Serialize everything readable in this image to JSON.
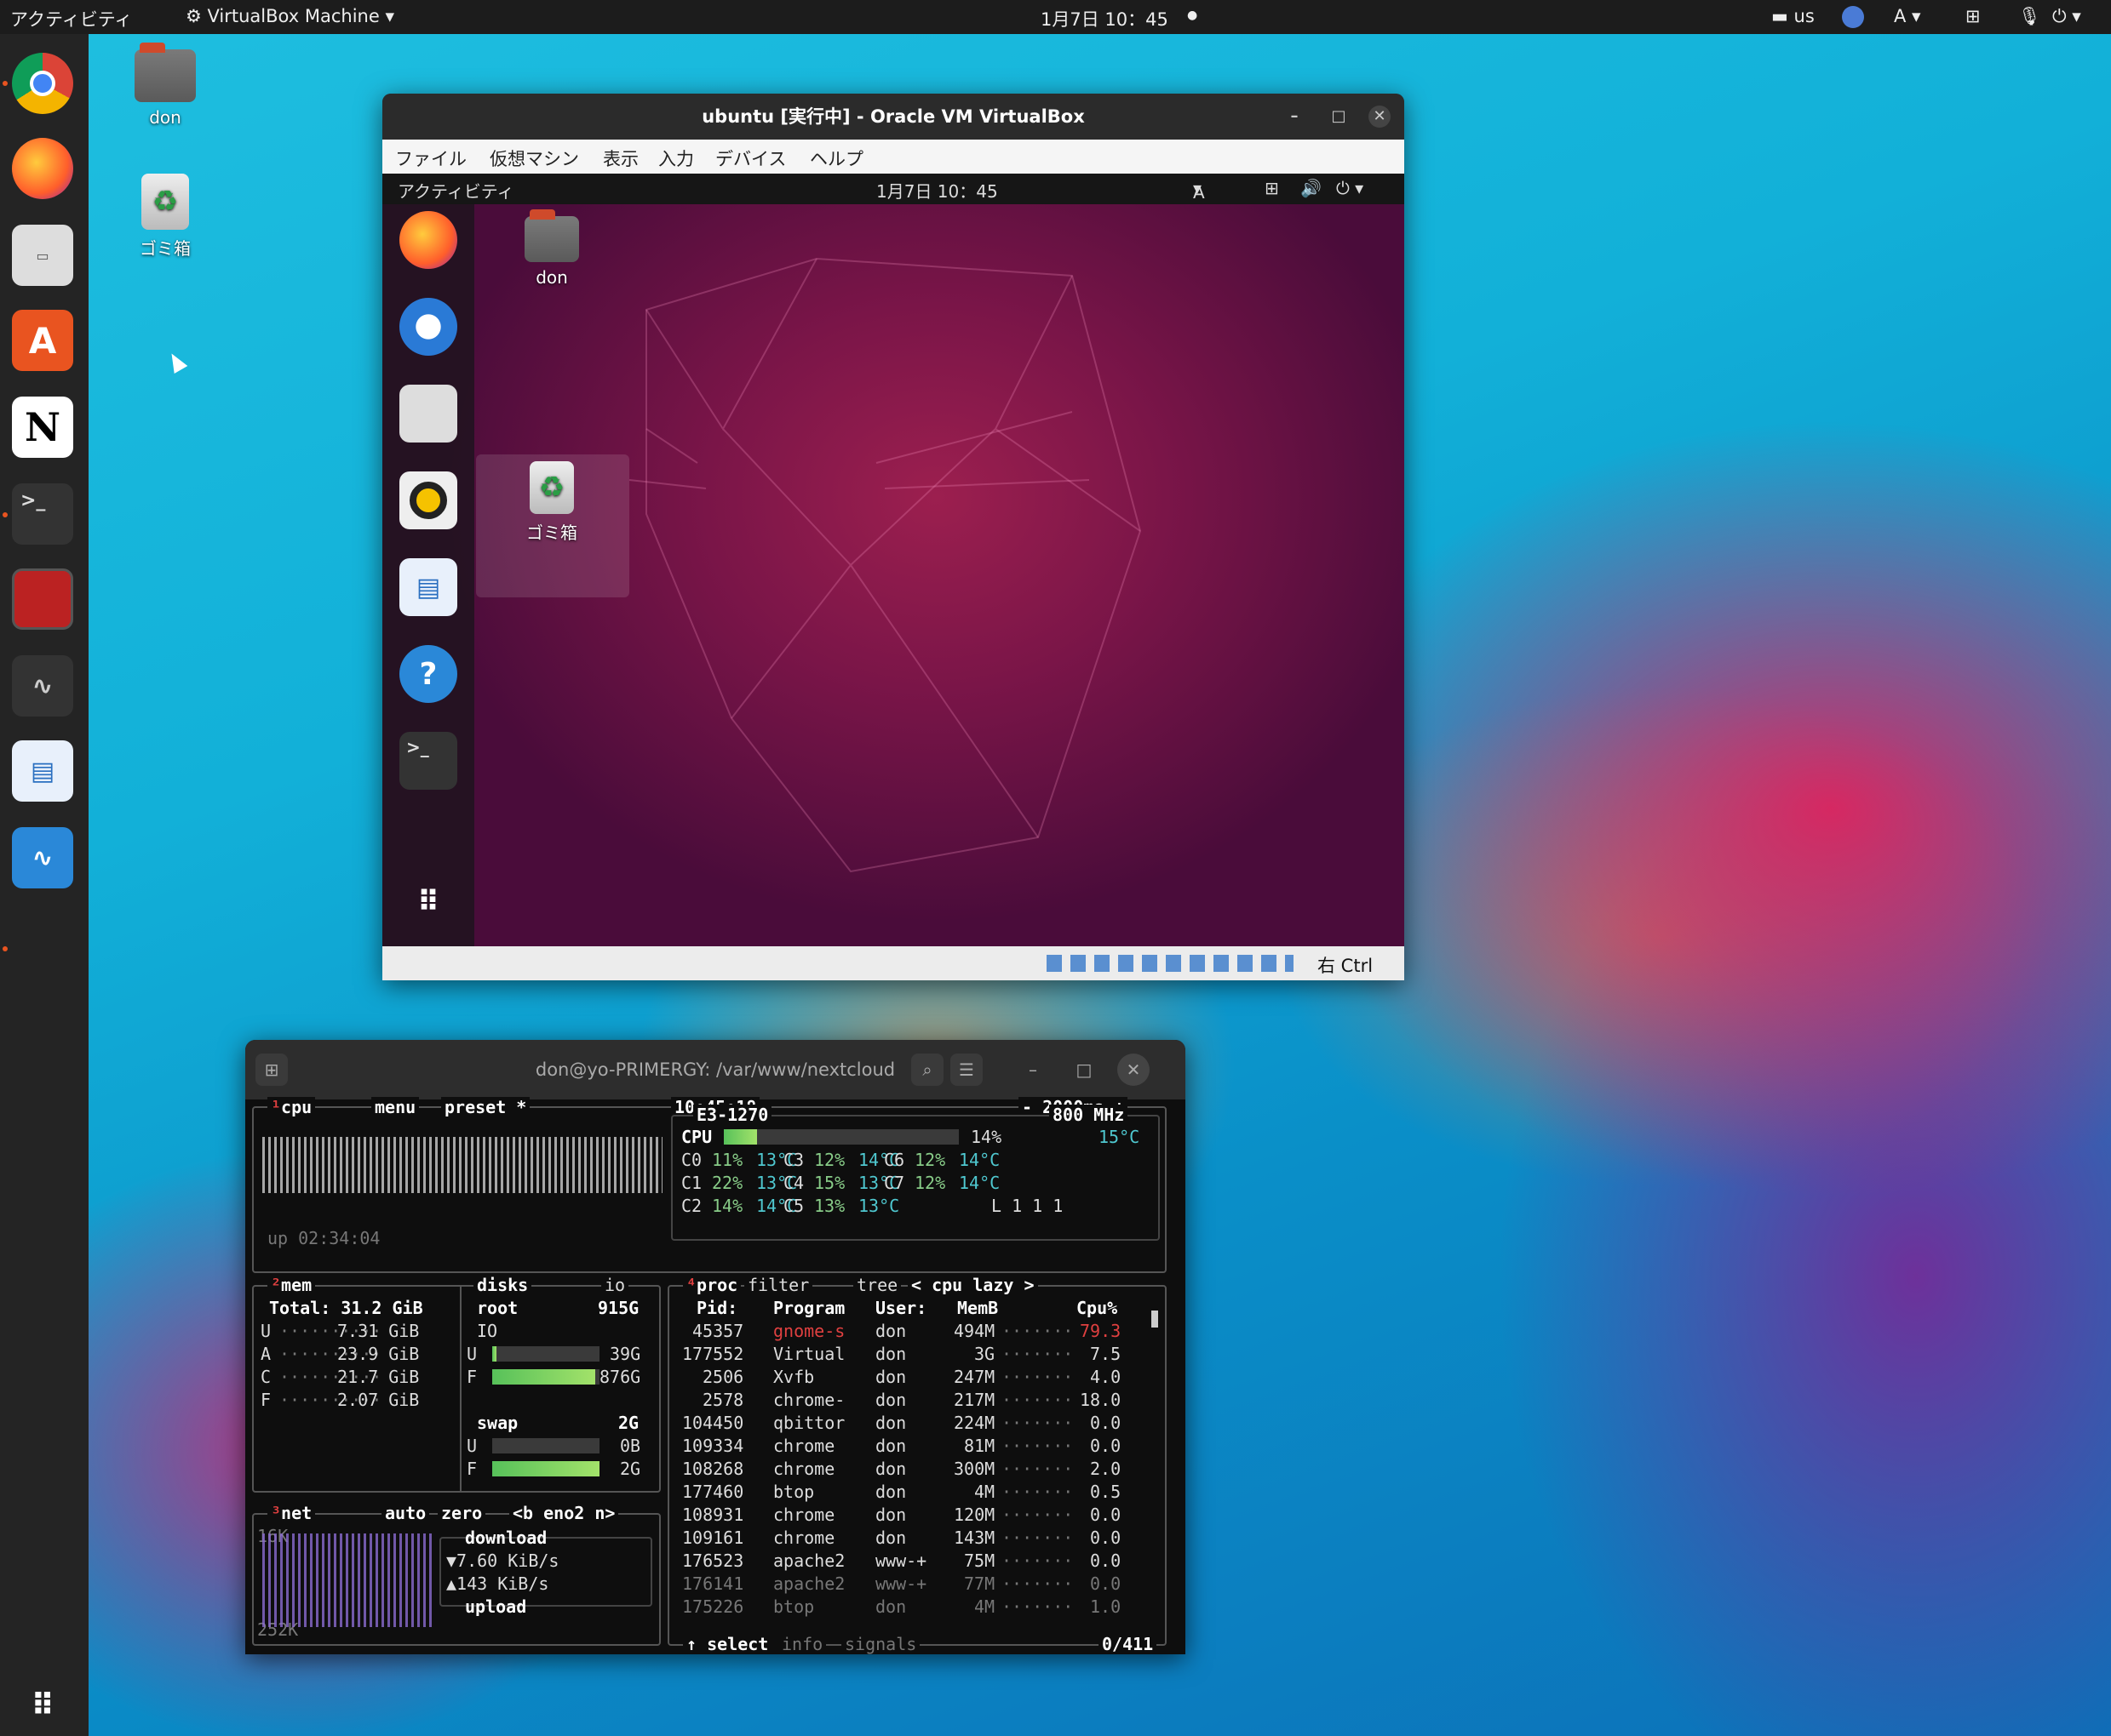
{
  "topbar": {
    "activities": "アクティビティ",
    "app": "VirtualBox Machine",
    "datetime": "1月7日  10：45",
    "keyboard": "us",
    "input": "A"
  },
  "desktop": {
    "home": "don",
    "trash": "ゴミ箱"
  },
  "vbox": {
    "title": "ubuntu [実行中] - Oracle VM VirtualBox",
    "menu": [
      "ファイル",
      "仮想マシン",
      "表示",
      "入力",
      "デバイス",
      "ヘルプ"
    ],
    "guest_bar": {
      "activities": "アクティビティ",
      "datetime": "1月7日  10：45",
      "input": "A"
    },
    "guest_icons": {
      "home": "don",
      "trash": "ゴミ箱"
    },
    "host_key": "右 Ctrl"
  },
  "terminal": {
    "title": "don@yo-PRIMERGY: /var/www/nextcloud",
    "cpu": {
      "tabs": {
        "num": "¹",
        "cpu": "cpu",
        "menu": "menu",
        "preset": "preset *"
      },
      "clock": "10:45:18",
      "interval": "- 2000ms +",
      "model": "E3-1270",
      "freq": "800 MHz",
      "total_label": "CPU",
      "total_pct": "14%",
      "total_temp": "15°C",
      "total_fill": 0.14,
      "cores": [
        {
          "name": "C0",
          "pct": "11%",
          "temp": "13°C"
        },
        {
          "name": "C3",
          "pct": "12%",
          "temp": "14°C"
        },
        {
          "name": "C6",
          "pct": "12%",
          "temp": "14°C"
        },
        {
          "name": "C1",
          "pct": "22%",
          "temp": "13°C"
        },
        {
          "name": "C4",
          "pct": "15%",
          "temp": "13°C"
        },
        {
          "name": "C7",
          "pct": "12%",
          "temp": "14°C"
        },
        {
          "name": "C2",
          "pct": "14%",
          "temp": "14°C"
        },
        {
          "name": "C5",
          "pct": "13%",
          "temp": "13°C"
        }
      ],
      "load": "L 1 1 1",
      "uptime": "up 02:34:04"
    },
    "mem": {
      "label": "mem",
      "total": "Total: 31.2 GiB",
      "rows": [
        [
          "U",
          "7.31 GiB"
        ],
        [
          "A",
          "23.9 GiB"
        ],
        [
          "C",
          "21.7 GiB"
        ],
        [
          "F",
          "2.07 GiB"
        ]
      ]
    },
    "disks": {
      "label": "disks",
      "io_label": "io",
      "root": "root",
      "root_size": "915G",
      "io": "IO",
      "u": "U",
      "u_val": "39G",
      "u_fill": 0.04,
      "f": "F",
      "f_val": "876G",
      "f_fill": 0.96,
      "swap": "swap",
      "swap_size": "2G",
      "su": "U",
      "su_val": "0B",
      "su_fill": 0.0,
      "sf": "F",
      "sf_val": "2G",
      "sf_fill": 1.0
    },
    "net": {
      "label": "net",
      "auto": "auto",
      "zero": "zero",
      "iface": "<b eno2 n>",
      "top": "16K",
      "bottom": "252K",
      "download": "download",
      "down_rate": "7.60 KiB/s",
      "up_rate": "143 KiB/s",
      "upload": "upload"
    },
    "proc": {
      "label": "proc",
      "filter": "filter",
      "tree": "tree",
      "sort": "< cpu lazy >",
      "headers": [
        "Pid:",
        "Program",
        "User:",
        "MemB",
        "Cpu%"
      ],
      "rows": [
        [
          "45357",
          "gnome-s",
          "don",
          "494M",
          "79.3"
        ],
        [
          "177552",
          "Virtual",
          "don",
          "3G",
          "7.5"
        ],
        [
          "2506",
          "Xvfb",
          "don",
          "247M",
          "4.0"
        ],
        [
          "2578",
          "chrome-",
          "don",
          "217M",
          "18.0"
        ],
        [
          "104450",
          "qbittor",
          "don",
          "224M",
          "0.0"
        ],
        [
          "109334",
          "chrome",
          "don",
          "81M",
          "0.0"
        ],
        [
          "108268",
          "chrome",
          "don",
          "300M",
          "2.0"
        ],
        [
          "177460",
          "btop",
          "don",
          "4M",
          "0.5"
        ],
        [
          "108931",
          "chrome",
          "don",
          "120M",
          "0.0"
        ],
        [
          "109161",
          "chrome",
          "don",
          "143M",
          "0.0"
        ],
        [
          "176523",
          "apache2",
          "www-+",
          "75M",
          "0.0"
        ],
        [
          "176141",
          "apache2",
          "www-+",
          "77M",
          "0.0"
        ],
        [
          "175226",
          "btop",
          "don",
          "4M",
          "1.0"
        ]
      ],
      "footer": {
        "select": "select",
        "info": "info",
        "signals": "signals",
        "count": "0/411"
      }
    }
  }
}
